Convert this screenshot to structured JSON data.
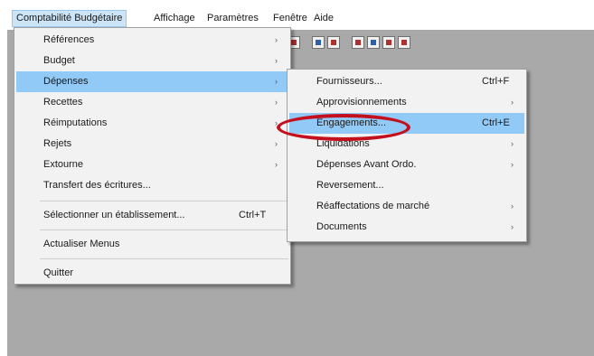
{
  "menubar": {
    "items": [
      "Comptabilité Budgétaire",
      "Affichage",
      "Paramètres",
      "Fenêtre",
      "Aide"
    ]
  },
  "main_menu": {
    "items": [
      {
        "label": "Références",
        "submenu": true
      },
      {
        "label": "Budget",
        "submenu": true
      },
      {
        "label": "Dépenses",
        "submenu": true,
        "highlighted": true
      },
      {
        "label": "Recettes",
        "submenu": true
      },
      {
        "label": "Réimputations",
        "submenu": true
      },
      {
        "label": "Rejets",
        "submenu": true
      },
      {
        "label": "Extourne",
        "submenu": true
      },
      {
        "label": "Transfert des écritures..."
      },
      {
        "label": "Sélectionner un établissement...",
        "shortcut": "Ctrl+T"
      },
      {
        "label": "Actualiser Menus"
      },
      {
        "label": "Quitter"
      }
    ],
    "arrow": "›"
  },
  "submenu_depenses": {
    "items": [
      {
        "label": "Fournisseurs...",
        "shortcut": "Ctrl+F"
      },
      {
        "label": "Approvisionnements",
        "submenu": true
      },
      {
        "label": "Engagements...",
        "shortcut": "Ctrl+E",
        "highlighted": true
      },
      {
        "label": "Liquidations",
        "submenu": true
      },
      {
        "label": "Dépenses Avant Ordo.",
        "submenu": true
      },
      {
        "label": "Reversement..."
      },
      {
        "label": "Réaffectations de marché",
        "submenu": true
      },
      {
        "label": "Documents",
        "submenu": true
      }
    ]
  },
  "colors": {
    "highlight": "#91c9f7",
    "annotation": "#c3101c",
    "workspace": "#a9a9a9"
  },
  "toolbar_icons": [
    "toolbar-icon"
  ]
}
